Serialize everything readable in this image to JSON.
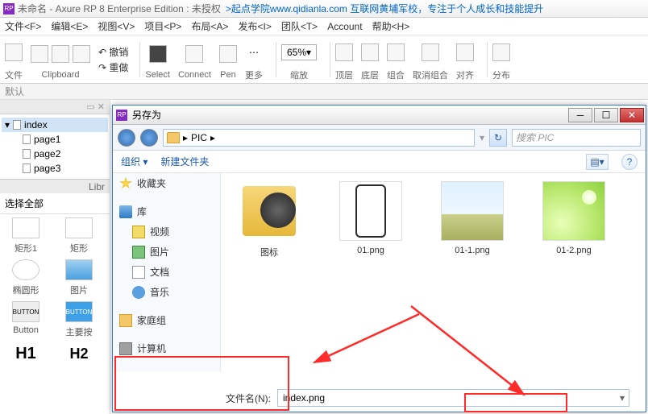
{
  "app": {
    "title_prefix": "未命名 - Axure RP 8 Enterprise Edition : 未授权",
    "promo": ">起点学院www.qidianla.com 互联网黄埔军校，专注于个人成长和技能提升"
  },
  "menu": {
    "file": "文件<F>",
    "edit": "编辑<E>",
    "view": "视图<V>",
    "project": "项目<P>",
    "layout": "布局<A>",
    "publish": "发布<I>",
    "team": "团队<T>",
    "account": "Account",
    "help": "帮助<H>"
  },
  "toolbar": {
    "file": "文件",
    "clipboard": "Clipboard",
    "undo": "撤销",
    "redo": "重做",
    "select": "Select",
    "connect": "Connect",
    "pen": "Pen",
    "more": "更多",
    "zoom_value": "65%",
    "zoom_label": "缩放",
    "top": "顶层",
    "bottom": "底层",
    "group": "组合",
    "ungroup": "取消组合",
    "align": "对齐",
    "distribute": "分布"
  },
  "sub_bar": {
    "default": "默认"
  },
  "pages": {
    "root": "index",
    "items": [
      "page1",
      "page2",
      "page3"
    ]
  },
  "library": {
    "header": "Libr",
    "select_all": "选择全部",
    "shapes": {
      "rect1": "矩形1",
      "rect": "矩形",
      "ellipse": "椭圆形",
      "img": "图片",
      "button": "Button",
      "primary": "主要按",
      "h1": "H1",
      "h2": "H2",
      "btn_text": "BUTTON"
    }
  },
  "dialog": {
    "title": "另存为",
    "path_label": "PIC",
    "search_placeholder": "搜索 PIC",
    "organize": "组织",
    "new_folder": "新建文件夹",
    "sidebar": {
      "favorites": "收藏夹",
      "libraries": "库",
      "videos": "视频",
      "pictures": "图片",
      "documents": "文档",
      "music": "音乐",
      "homegroup": "家庭组",
      "computer": "计算机"
    },
    "files": {
      "folder": "图标",
      "f1": "01.png",
      "f2": "01-1.png",
      "f3": "01-2.png"
    },
    "filename_label": "文件名(N):",
    "filename_value": "index.png"
  }
}
